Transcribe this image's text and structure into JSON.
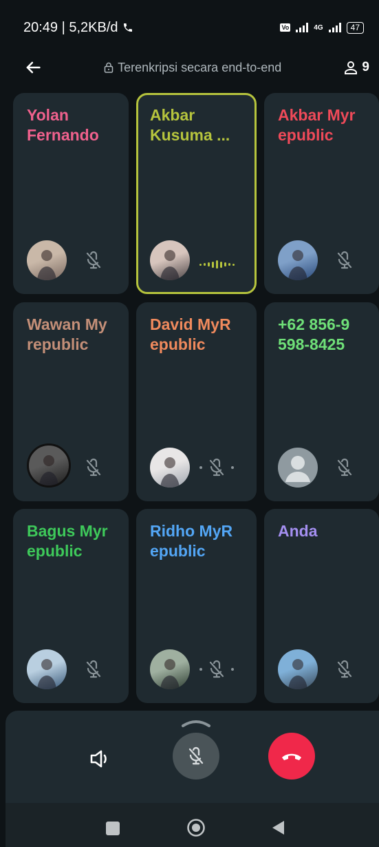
{
  "status_bar": {
    "time_speed": "20:49 | 5,2KB/d",
    "network_4g": "4G",
    "battery": "47"
  },
  "topbar": {
    "encryption_text": "Terenkripsi secara end-to-end",
    "participant_count": "9"
  },
  "tiles": [
    {
      "name": "Yolan Fernando",
      "display_lines": [
        "Yolan",
        "Fernando"
      ],
      "color": "#f0618d",
      "state": "muted",
      "avatar": "photo"
    },
    {
      "name": "Akbar Kusuma",
      "display_lines": [
        "Akbar",
        "Kusuma ..."
      ],
      "color": "#b6c43d",
      "state": "speaking",
      "avatar": "photo"
    },
    {
      "name": "Akbar Myrepublic",
      "display_lines": [
        "Akbar Myr",
        "epublic"
      ],
      "color": "#ef4a59",
      "state": "muted",
      "avatar": "photo"
    },
    {
      "name": "Wawan Myrepublic",
      "display_lines": [
        "Wawan My",
        "republic"
      ],
      "color": "#c48f78",
      "state": "muted",
      "avatar": "photo"
    },
    {
      "name": "David MyRepublic",
      "display_lines": [
        "David MyR",
        "epublic"
      ],
      "color": "#f08a5d",
      "state": "connecting",
      "avatar": "photo"
    },
    {
      "name": "+62 856-9598-8425",
      "display_lines": [
        "+62 856-9",
        "598-8425"
      ],
      "color": "#6fe078",
      "state": "muted",
      "avatar": "default"
    },
    {
      "name": "Bagus Myrepublic",
      "display_lines": [
        "Bagus Myr",
        "epublic"
      ],
      "color": "#3ec95a",
      "state": "muted",
      "avatar": "photo"
    },
    {
      "name": "Ridho MyRepublic",
      "display_lines": [
        "Ridho MyR",
        "epublic"
      ],
      "color": "#53a6f5",
      "state": "connecting",
      "avatar": "photo"
    },
    {
      "name": "Anda",
      "display_lines": [
        "Anda"
      ],
      "color": "#a48ff0",
      "state": "muted",
      "avatar": "photo"
    }
  ],
  "controls": {
    "speaker_icon": "speaker-icon",
    "mute_icon": "mic-off-icon",
    "end_call_icon": "end-call-icon",
    "end_call_color": "#f0284a"
  },
  "accent_speaking": "#b6c43d"
}
